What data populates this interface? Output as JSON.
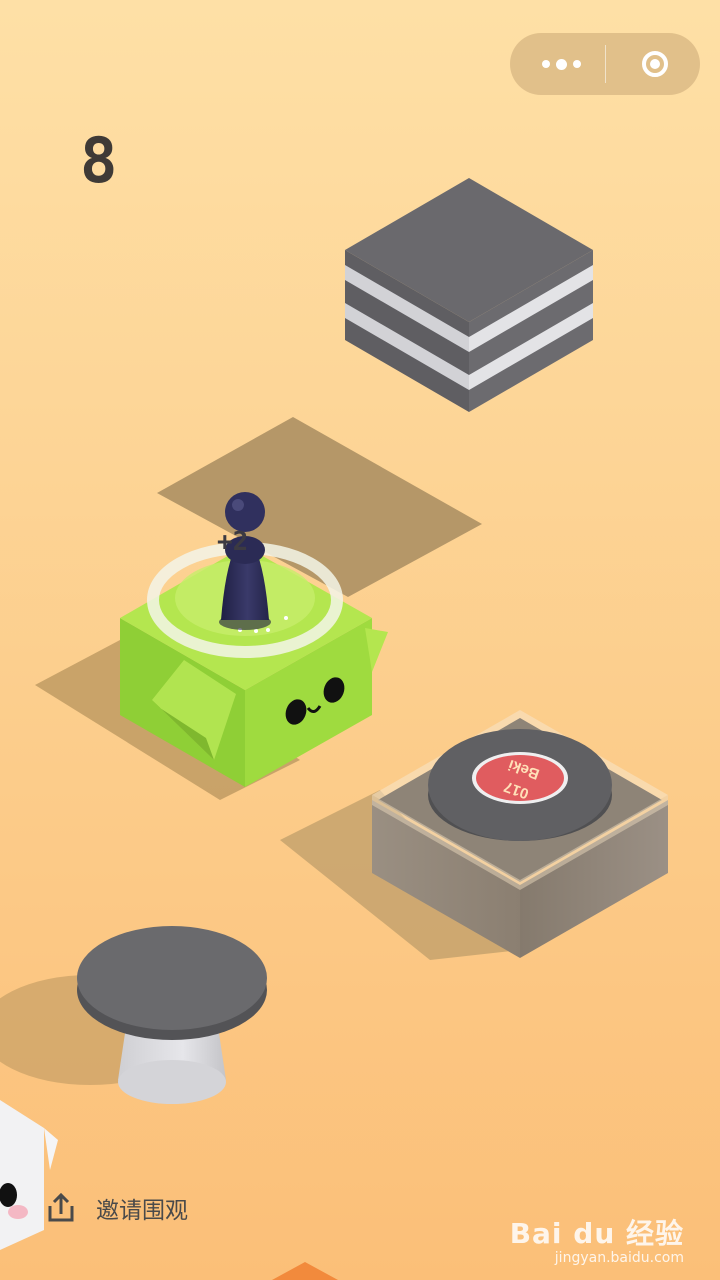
{
  "capsule": {
    "more_icon": "more-dots-icon",
    "close_icon": "target-close-icon"
  },
  "hud": {
    "score": "8",
    "plus_score": "+2"
  },
  "record": {
    "label_top": "Beki",
    "label_bottom": "017"
  },
  "share": {
    "label": "邀请围观",
    "icon": "share-upload-icon"
  },
  "watermark": {
    "main": "Bai du 经验",
    "sub": "jingyan.baidu.com"
  },
  "colors": {
    "background_top": "#fddfa4",
    "background_bottom": "#fbbf75",
    "green_block": "#a2de3e",
    "player": "#2e2e55",
    "gray_block": "#68676a",
    "wood_block": "#8f8474",
    "record_label": "#e05c5f"
  }
}
